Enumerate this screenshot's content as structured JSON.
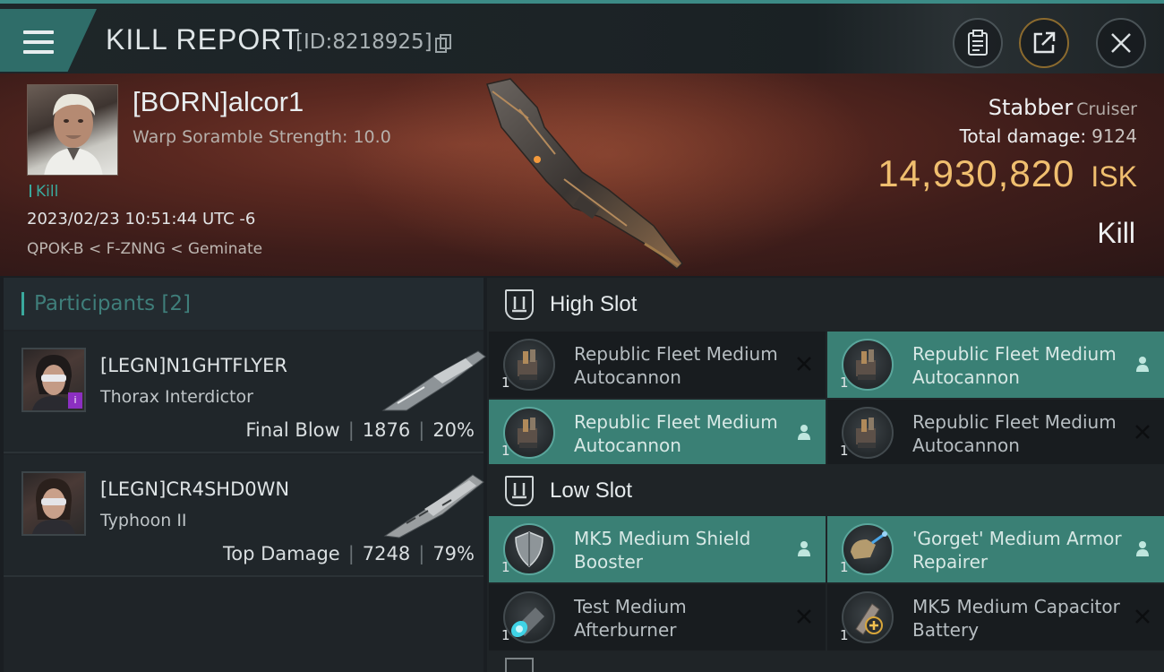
{
  "header": {
    "title": "KILL REPORT",
    "report_id": "[ID:8218925]"
  },
  "victim": {
    "name": "[BORN]alcor1",
    "scramble": "Warp Soramble Strength: 10.0",
    "kill_tag": "Kill",
    "timestamp": "2023/02/23 10:51:44 UTC -6",
    "location": "QPOK-B < F-ZNNG < Geminate",
    "ship_name": "Stabber",
    "ship_class": "Cruiser",
    "total_damage_label": "Total damage:",
    "total_damage": "9124",
    "isk_value": "14,930,820",
    "isk_unit": "ISK",
    "result": "Kill"
  },
  "participants": {
    "label": "Participants",
    "count": "[2]",
    "items": [
      {
        "name": "[LEGN]N1GHTFLYER",
        "ship": "Thorax Interdictor",
        "role": "Final Blow",
        "damage": "1876",
        "percent": "20%",
        "badge": "i"
      },
      {
        "name": "[LEGN]CR4SHD0WN",
        "ship": "Typhoon II",
        "role": "Top Damage",
        "damage": "7248",
        "percent": "79%"
      }
    ]
  },
  "slots": {
    "high": {
      "title": "High Slot",
      "modules": [
        {
          "name": "Republic Fleet Medium Autocannon",
          "qty": "1",
          "status": "destroyed"
        },
        {
          "name": "Republic Fleet Medium Autocannon",
          "qty": "1",
          "status": "dropped"
        },
        {
          "name": "Republic Fleet Medium Autocannon",
          "qty": "1",
          "status": "dropped"
        },
        {
          "name": "Republic Fleet Medium Autocannon",
          "qty": "1",
          "status": "destroyed"
        }
      ]
    },
    "low": {
      "title": "Low Slot",
      "modules": [
        {
          "name": "MK5 Medium Shield Booster",
          "qty": "1",
          "status": "dropped"
        },
        {
          "name": "'Gorget' Medium Armor Repairer",
          "qty": "1",
          "status": "dropped"
        },
        {
          "name": "Test Medium Afterburner",
          "qty": "1",
          "status": "destroyed"
        },
        {
          "name": "MK5 Medium Capacitor Battery",
          "qty": "1",
          "status": "destroyed"
        }
      ]
    }
  },
  "colors": {
    "accent": "#3aa99d",
    "isk": "#f0bf6f",
    "dropped_bg": "#3a8075",
    "destroyed_bg": "#181c1f",
    "badge": "#8c2fc2"
  },
  "icons": {
    "menu": "hamburger-icon",
    "copy": "copy-icon",
    "clipboard": "clipboard-icon",
    "share": "share-icon",
    "close": "close-icon",
    "slot": "slot-icon",
    "dropped": "person-icon",
    "destroyed": "x-icon"
  }
}
